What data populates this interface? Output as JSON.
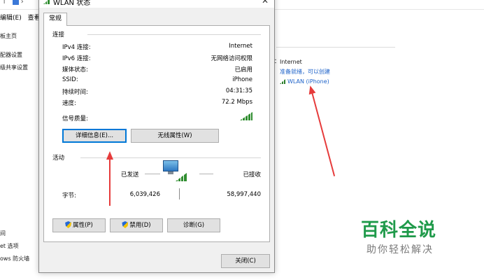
{
  "background": {
    "nav_arrow": "↑",
    "nav_chevron": "›",
    "menu": [
      "编辑(E)",
      "查看("
    ],
    "left_items": [
      "板主页",
      "配器设置",
      "级共享设置",
      "间",
      "et 选项",
      "ows 防火墙"
    ],
    "info": {
      "access_type": "Internet",
      "homegroup": "准备就绪，可以创建",
      "connection": "WLAN (iPhone)"
    },
    "separator_label": "："
  },
  "dialog": {
    "title": "WLAN 状态",
    "close_glyph": "✕",
    "tab": "常规",
    "connection_group": "连接",
    "rows": [
      {
        "key": "IPv4 连接:",
        "value": "Internet"
      },
      {
        "key": "IPv6 连接:",
        "value": "无网络访问权限"
      },
      {
        "key": "媒体状态:",
        "value": "已启用"
      },
      {
        "key": "SSID:",
        "value": "iPhone"
      },
      {
        "key": "持续时间:",
        "value": "04:31:35"
      },
      {
        "key": "速度:",
        "value": "72.2 Mbps"
      }
    ],
    "signal_label": "信号质量:",
    "details_button": "详细信息(E)...",
    "wireless_props_button": "无线属性(W)",
    "activity_group": "活动",
    "sent_label": "已发送",
    "received_label": "已接收",
    "bytes_label": "字节:",
    "bytes_sent": "6,039,426",
    "bytes_received": "58,997,440",
    "properties_button": "属性(P)",
    "disable_button": "禁用(D)",
    "diagnose_button": "诊断(G)",
    "close_button": "关闭(C)"
  },
  "watermark": {
    "main": "百科全说",
    "sub": "助你轻松解决"
  },
  "colors": {
    "accent": "#0078d7",
    "signal_green": "#2f8d2f",
    "arrow_red": "#e63b3b",
    "link_blue": "#1d62c9",
    "watermark_green": "#1f9a4a"
  }
}
